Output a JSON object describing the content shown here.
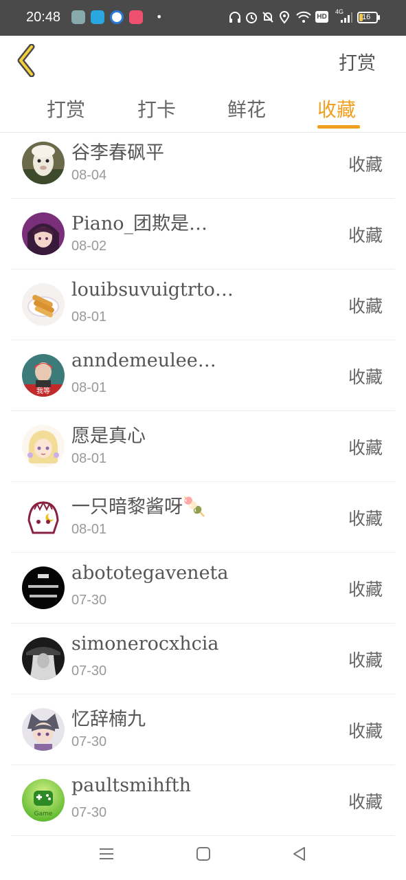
{
  "status_bar": {
    "time": "20:48",
    "battery": "16",
    "network": "4G",
    "hd": "HD"
  },
  "header": {
    "right_label": "打赏"
  },
  "tabs": [
    {
      "label": "打赏"
    },
    {
      "label": "打卡"
    },
    {
      "label": "鲜花"
    },
    {
      "label": "收藏"
    }
  ],
  "active_tab": "收藏",
  "colors": {
    "accent": "#f0a020",
    "status_bar": "#4a4a4a",
    "text": "#555555",
    "subtext": "#999999"
  },
  "items": [
    {
      "name": "谷李春砜平",
      "date": "08-04",
      "action": "收藏",
      "avatar": "alpaca"
    },
    {
      "name": "Piano_团欺是…",
      "date": "08-02",
      "action": "收藏",
      "avatar": "anime-purple"
    },
    {
      "name": "louibsuvuigtrto…",
      "date": "08-01",
      "action": "收藏",
      "avatar": "snack"
    },
    {
      "name": "anndemeulee…",
      "date": "08-01",
      "action": "收藏",
      "avatar": "portrait"
    },
    {
      "name": "愿是真心",
      "date": "08-01",
      "action": "收藏",
      "avatar": "anime-blonde"
    },
    {
      "name": "一只暗黎酱呀🍡",
      "date": "08-01",
      "action": "收藏",
      "avatar": "cartoon"
    },
    {
      "name": "abototegaveneta",
      "date": "07-30",
      "action": "收藏",
      "avatar": "text-black"
    },
    {
      "name": "simonerocxhcia",
      "date": "07-30",
      "action": "收藏",
      "avatar": "bw-photo"
    },
    {
      "name": "忆辞楠九",
      "date": "07-30",
      "action": "收藏",
      "avatar": "anime-hat"
    },
    {
      "name": "paultsmihfth",
      "date": "07-30",
      "action": "收藏",
      "avatar": "game"
    }
  ]
}
